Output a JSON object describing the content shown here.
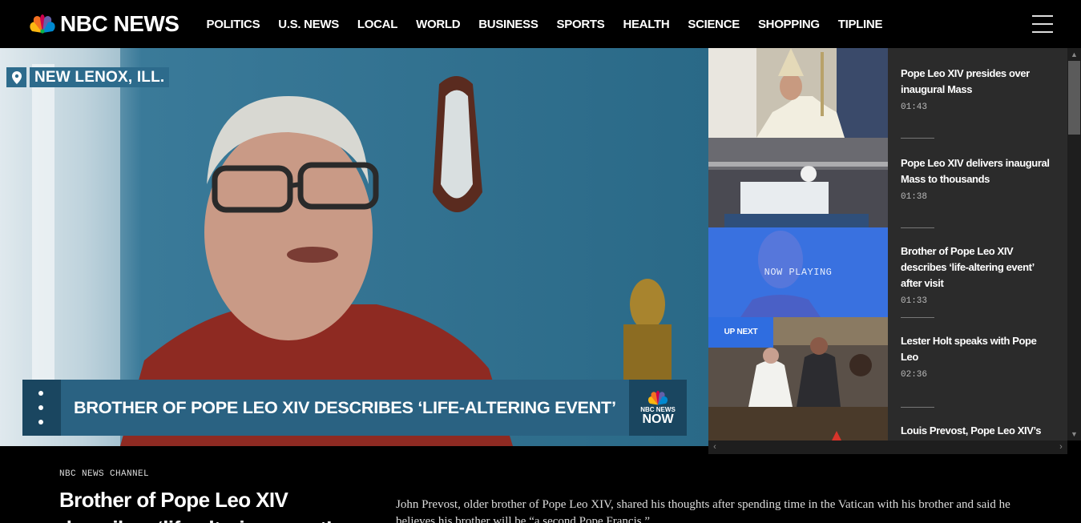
{
  "brand": {
    "name": "NBC NEWS",
    "peacock_colors": [
      "#fcb711",
      "#f37021",
      "#cc004c",
      "#6460aa",
      "#0089d0",
      "#0db14b"
    ]
  },
  "nav": {
    "items": [
      "POLITICS",
      "U.S. NEWS",
      "LOCAL",
      "WORLD",
      "BUSINESS",
      "SPORTS",
      "HEALTH",
      "SCIENCE",
      "SHOPPING",
      "TIPLINE"
    ],
    "menu_icon": "hamburger-menu-icon"
  },
  "player": {
    "location": "NEW LENOX, ILL.",
    "location_icon": "map-pin-icon",
    "lower_third": "BROTHER OF POPE LEO XIV DESCRIBES ‘LIFE-ALTERING EVENT’",
    "bug_small": "NBC NEWS",
    "bug_big": "NOW"
  },
  "playlist": {
    "now_playing_label": "NOW PLAYING",
    "up_next_label": "UP NEXT",
    "items": [
      {
        "title": "Pope Leo XIV presides over inaugural Mass",
        "duration": "01:43"
      },
      {
        "title": "Pope Leo XIV delivers inaugural Mass to thousands",
        "duration": "01:38"
      },
      {
        "title": "Brother of Pope Leo XIV describes ‘life-altering event’ after visit",
        "duration": "01:33"
      },
      {
        "title": "Lester Holt speaks with Pope Leo",
        "duration": "02:36"
      },
      {
        "title": "Louis Prevost, Pope Leo XIV’s",
        "duration": ""
      }
    ]
  },
  "article": {
    "eyebrow": "NBC NEWS CHANNEL",
    "headline": "Brother of Pope Leo XIV describes ‘life-altering event’",
    "dek": "John Prevost, older brother of Pope Leo XIV, shared his thoughts after spending time in the Vatican with his brother and said he believes his brother will be “a second Pope Francis.”"
  },
  "colors": {
    "accent_blue": "#2f6de0",
    "lower_third_blue": "#2a6282",
    "playlist_bg": "#2b2b2b"
  }
}
